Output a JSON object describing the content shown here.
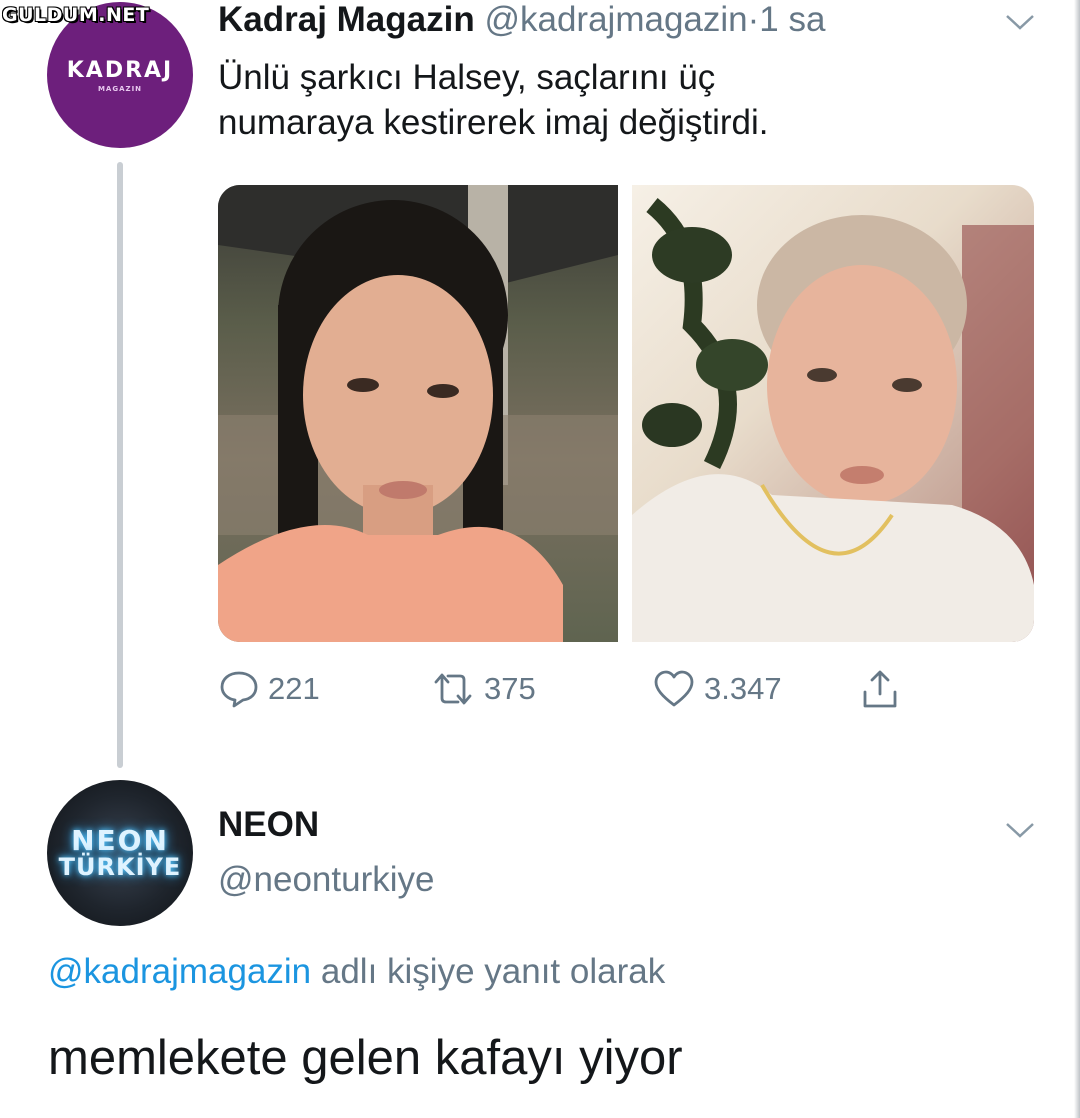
{
  "watermark": "GULDUM.NET",
  "colors": {
    "text": "#14171a",
    "secondary": "#657786",
    "link": "#1b95e0",
    "kadraj_avatar": "#6d1f7c",
    "neon_glow": "#59c8ff"
  },
  "tweet": {
    "author_name": "Kadraj Magazin",
    "author_handle": "@kadrajmagazin",
    "separator": "·",
    "time": "1 sa",
    "avatar_text": "KADRAJ",
    "avatar_subtext": "MAGAZIN",
    "text_line1": "Ünlü şarkıcı Halsey, saçlarını üç",
    "text_line2": "numaraya kestirerek imaj değiştirdi.",
    "more_icon": "chevron-down-icon",
    "actions": {
      "reply_icon": "comment-icon",
      "reply_count": "221",
      "retweet_icon": "retweet-icon",
      "retweet_count": "375",
      "like_icon": "heart-icon",
      "like_count": "3.347",
      "share_icon": "share-icon"
    }
  },
  "reply": {
    "author_name": "NEON",
    "author_handle": "@neonturkiye",
    "avatar_line1": "NEON",
    "avatar_line2": "TÜRKİYE",
    "more_icon": "chevron-down-icon",
    "replying_to_mention": "@kadrajmagazin",
    "replying_to_suffix": " adlı kişiye yanıt olarak",
    "text": "memlekete gelen kafayı yiyor"
  }
}
